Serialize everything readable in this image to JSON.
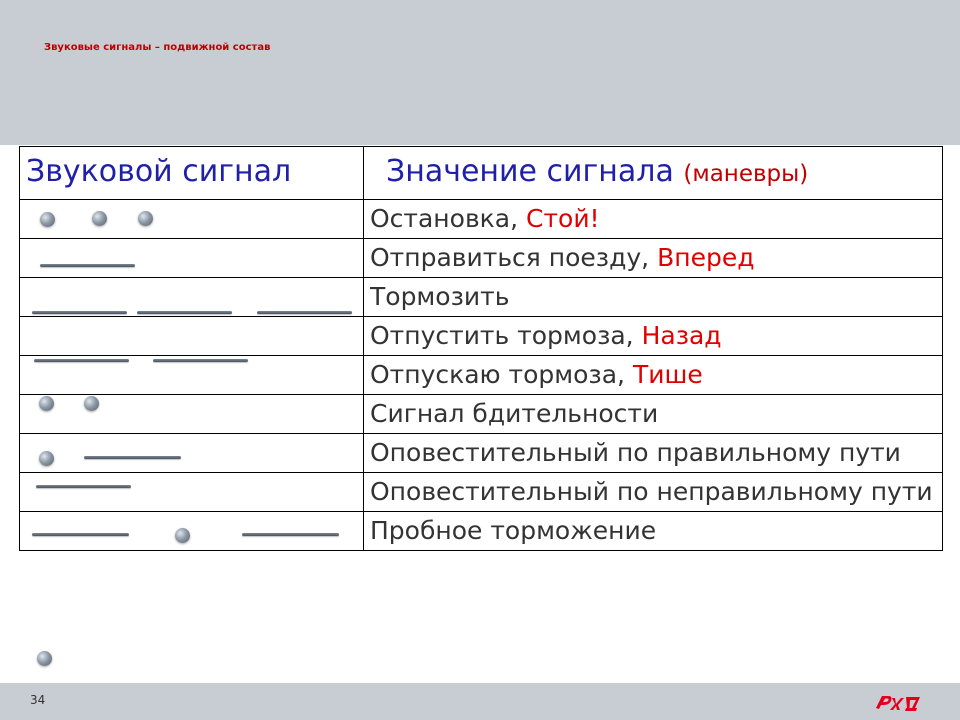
{
  "slide": {
    "title": "Звуковые сигналы – подвижной состав",
    "page_number": "34",
    "logo_text": "РЖД"
  },
  "table": {
    "col1_header": "Звуковой сигнал",
    "col2_header": "Значение сигнала",
    "col2_header_note": "(маневры)",
    "rows": [
      {
        "signal_pattern": [
          "short",
          "short",
          "short"
        ],
        "meaning": "Остановка,",
        "command": "Стой!"
      },
      {
        "signal_pattern": [
          "long"
        ],
        "meaning": "Отправиться поезду,",
        "command": "Вперед"
      },
      {
        "signal_pattern": [
          "long",
          "long",
          "long"
        ],
        "meaning": "Тормозить",
        "command": ""
      },
      {
        "signal_pattern": [],
        "meaning": "Отпустить тормоза,",
        "command": "Назад"
      },
      {
        "signal_pattern": [
          "long",
          "long"
        ],
        "meaning": "Отпускаю тормоза,",
        "command": "Тише"
      },
      {
        "signal_pattern": [
          "short",
          "short"
        ],
        "meaning": "Сигнал бдительности",
        "command": ""
      },
      {
        "signal_pattern": [
          "short",
          "long"
        ],
        "meaning": "Оповестительный по правильному пути",
        "command": ""
      },
      {
        "signal_pattern": [
          "long"
        ],
        "meaning": "Оповестительный по неправильному пути",
        "command": ""
      },
      {
        "signal_pattern": [
          "long",
          "short",
          "long"
        ],
        "meaning": "Пробное торможение",
        "command": ""
      }
    ],
    "trailing_signal": [
      "short"
    ]
  },
  "colors": {
    "header_band": "#c8ccd3",
    "title_red": "#c00000",
    "column_header_blue": "#1f1fa8",
    "command_red": "#e00000",
    "body_text": "#333333"
  }
}
